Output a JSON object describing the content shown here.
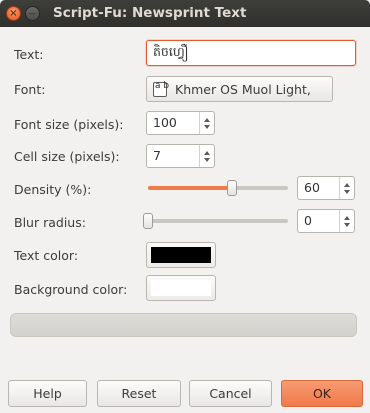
{
  "window": {
    "title": "Script-Fu: Newsprint Text",
    "close_glyph": "×",
    "minimize_glyph": "—"
  },
  "fields": {
    "text": {
      "label": "Text:",
      "value": "តិចហ្វឿ"
    },
    "font": {
      "label": "Font:",
      "value": "Khmer OS Muol Light,",
      "icon_glyph": "a b"
    },
    "font_size": {
      "label": "Font size (pixels):",
      "value": "100"
    },
    "cell_size": {
      "label": "Cell size (pixels):",
      "value": "7"
    },
    "density": {
      "label": "Density (%):",
      "value": "60",
      "slider_fraction": 0.6
    },
    "blur_radius": {
      "label": "Blur radius:",
      "value": "0",
      "slider_fraction": 0.0
    },
    "text_color": {
      "label": "Text color:",
      "color": "#000000"
    },
    "background_color": {
      "label": "Background color:",
      "color": "#ffffff"
    }
  },
  "progress": {
    "fraction": 0.0
  },
  "buttons": {
    "help": "Help",
    "reset": "Reset",
    "cancel": "Cancel",
    "ok": "OK"
  },
  "colors": {
    "accent": "#f07746",
    "titlebar": "#3c3b37"
  }
}
